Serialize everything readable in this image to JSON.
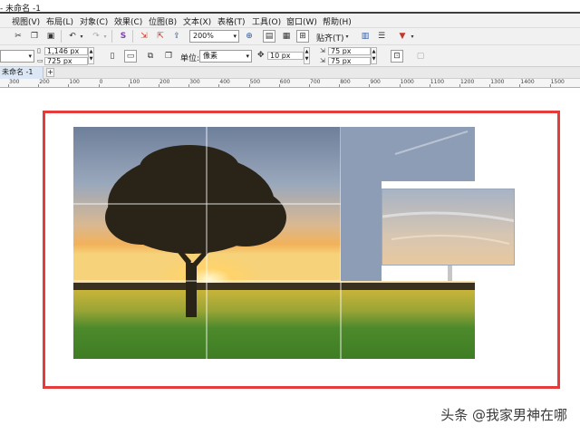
{
  "window": {
    "title": "- 未命名 -1"
  },
  "menu": {
    "items": [
      {
        "label": "视图(V)"
      },
      {
        "label": "布局(L)"
      },
      {
        "label": "对象(C)"
      },
      {
        "label": "效果(C)"
      },
      {
        "label": "位图(B)"
      },
      {
        "label": "文本(X)"
      },
      {
        "label": "表格(T)"
      },
      {
        "label": "工具(O)"
      },
      {
        "label": "窗口(W)"
      },
      {
        "label": "帮助(H)"
      }
    ]
  },
  "toolbar": {
    "zoom": "200%",
    "snap_label": "贴齐(T)"
  },
  "property_bar": {
    "width": "1,146 px",
    "height": "725 px",
    "unit_label": "单位:",
    "unit_value": "像素",
    "nudge": "10 px",
    "dup_x": "75 px",
    "dup_y": "75 px"
  },
  "document": {
    "tab_label": "未命名 -1"
  },
  "ruler": {
    "labels": [
      "300",
      "200",
      "100",
      "0",
      "100",
      "200",
      "300",
      "400",
      "500",
      "600",
      "700",
      "800",
      "900",
      "1000",
      "1100",
      "1200",
      "1300",
      "1400",
      "1500"
    ]
  },
  "watermark": {
    "text": "头条 @我家男神在哪"
  },
  "colors": {
    "frame_red": "#e43b3b",
    "menubar": "#f1f1f1",
    "doc_tab": "#dbe7f5"
  },
  "icons": [
    "cut-icon",
    "copy-icon",
    "paste-icon",
    "undo-icon",
    "redo-icon",
    "import-icon",
    "export-icon",
    "zoom-fit-icon",
    "nudge-icon",
    "duplicate-distance-icon"
  ]
}
